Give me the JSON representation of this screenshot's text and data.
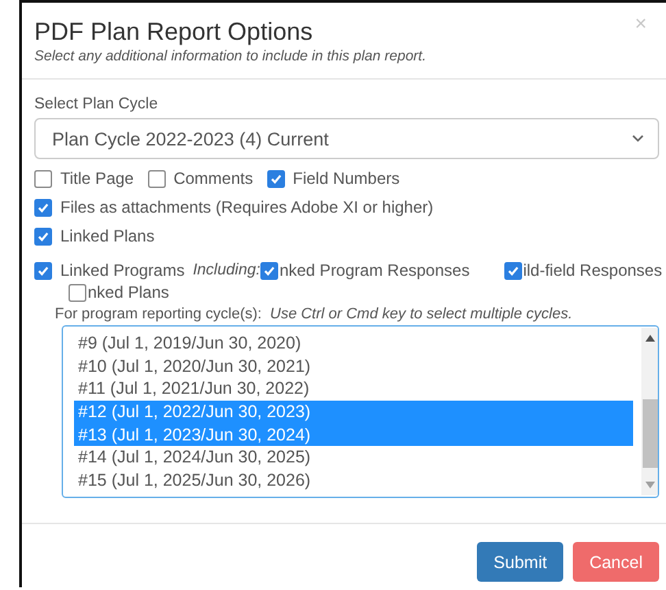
{
  "dialog": {
    "title": "PDF Plan Report Options",
    "subtitle": "Select any additional information to include in this plan report.",
    "close": "×"
  },
  "plan_cycle": {
    "label": "Select Plan Cycle",
    "value": "Plan Cycle 2022-2023 (4) Current"
  },
  "option_rows": [
    [
      {
        "label": "Title Page",
        "checked": false
      },
      {
        "label": "Comments",
        "checked": false
      },
      {
        "label": "Field Numbers",
        "checked": true
      }
    ],
    [
      {
        "label": "Files as attachments (Requires Adobe XI or higher)",
        "checked": true
      }
    ],
    [
      {
        "label": "Linked Plans",
        "checked": true
      }
    ]
  ],
  "linked_programs": {
    "label": "Linked Programs",
    "checked": true,
    "including": "Including:",
    "sub_options": [
      {
        "label": "nked Program Responses",
        "checked": true
      },
      {
        "label": "ild-field Responses",
        "checked": true
      },
      {
        "label": "nked Plans",
        "checked": false
      }
    ]
  },
  "cycles_prompt": {
    "label": "For program reporting cycle(s):",
    "hint": "Use Ctrl or Cmd key to select multiple cycles."
  },
  "cycles": [
    {
      "label": "#9 (Jul 1, 2019/Jun 30, 2020)",
      "selected": false
    },
    {
      "label": "#10 (Jul 1, 2020/Jun 30, 2021)",
      "selected": false
    },
    {
      "label": "#11 (Jul 1, 2021/Jun 30, 2022)",
      "selected": false
    },
    {
      "label": "#12 (Jul 1, 2022/Jun 30, 2023)",
      "selected": true
    },
    {
      "label": "#13 (Jul 1, 2023/Jun 30, 2024)",
      "selected": true
    },
    {
      "label": "#14 (Jul 1, 2024/Jun 30, 2025)",
      "selected": false
    },
    {
      "label": "#15 (Jul 1, 2025/Jun 30, 2026)",
      "selected": false
    }
  ],
  "buttons": [
    {
      "label": "Submit",
      "kind": "primary"
    },
    {
      "label": "Cancel",
      "kind": "danger"
    }
  ]
}
